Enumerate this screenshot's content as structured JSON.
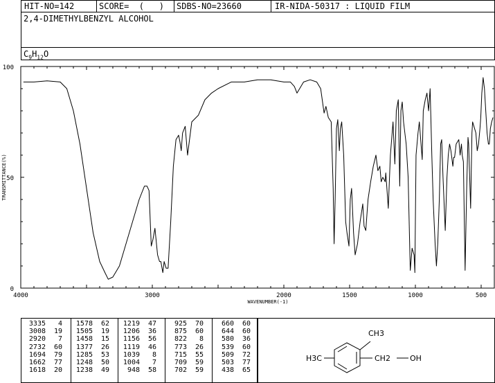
{
  "header": {
    "hit_no": "HIT-NO=142",
    "score": "SCORE=  (   )",
    "sdbs_no": "SDBS-NO=23660",
    "ir_info": "IR-NIDA-50317 : LIQUID FILM"
  },
  "compound": {
    "name": "2,4-DIMETHYLBENZYL ALCOHOL",
    "formula": {
      "c": "C",
      "c_count": "9",
      "h": "H",
      "h_count": "12",
      "o": "O"
    }
  },
  "chart_data": {
    "type": "line",
    "xlabel": "WAVENUMBER(-1)",
    "ylabel": "TRANSMITTANCE(%)",
    "xlim": [
      4000,
      400
    ],
    "ylim": [
      0,
      100
    ],
    "x_ticks": [
      "4000",
      "3000",
      "2000",
      "1500",
      "1000",
      "500"
    ],
    "y_ticks": [
      "100",
      "50",
      "0"
    ],
    "series": [
      {
        "points": [
          [
            3980,
            93
          ],
          [
            3900,
            93
          ],
          [
            3800,
            93.5
          ],
          [
            3700,
            93
          ],
          [
            3650,
            90
          ],
          [
            3600,
            80
          ],
          [
            3550,
            65
          ],
          [
            3500,
            45
          ],
          [
            3450,
            25
          ],
          [
            3400,
            12
          ],
          [
            3360,
            7
          ],
          [
            3335,
            4
          ],
          [
            3300,
            5
          ],
          [
            3250,
            10
          ],
          [
            3200,
            20
          ],
          [
            3150,
            30
          ],
          [
            3100,
            40
          ],
          [
            3060,
            46
          ],
          [
            3040,
            46
          ],
          [
            3025,
            44
          ],
          [
            3008,
            19
          ],
          [
            2995,
            22
          ],
          [
            2980,
            27
          ],
          [
            2960,
            15
          ],
          [
            2945,
            12
          ],
          [
            2935,
            12
          ],
          [
            2920,
            7
          ],
          [
            2910,
            12
          ],
          [
            2895,
            9
          ],
          [
            2880,
            9
          ],
          [
            2860,
            30
          ],
          [
            2840,
            55
          ],
          [
            2820,
            67
          ],
          [
            2800,
            69
          ],
          [
            2790,
            66
          ],
          [
            2780,
            62
          ],
          [
            2770,
            70
          ],
          [
            2750,
            73
          ],
          [
            2732,
            60
          ],
          [
            2700,
            75
          ],
          [
            2650,
            78
          ],
          [
            2600,
            85
          ],
          [
            2550,
            88
          ],
          [
            2500,
            90
          ],
          [
            2400,
            93
          ],
          [
            2300,
            93
          ],
          [
            2200,
            94
          ],
          [
            2100,
            94
          ],
          [
            2000,
            93
          ],
          [
            1950,
            93
          ],
          [
            1920,
            91
          ],
          [
            1900,
            88
          ],
          [
            1880,
            90
          ],
          [
            1850,
            93
          ],
          [
            1800,
            94
          ],
          [
            1750,
            93
          ],
          [
            1720,
            90
          ],
          [
            1694,
            79
          ],
          [
            1680,
            82
          ],
          [
            1662,
            77
          ],
          [
            1640,
            75
          ],
          [
            1625,
            45
          ],
          [
            1618,
            20
          ],
          [
            1610,
            40
          ],
          [
            1600,
            72
          ],
          [
            1590,
            76
          ],
          [
            1578,
            62
          ],
          [
            1570,
            72
          ],
          [
            1560,
            75
          ],
          [
            1545,
            60
          ],
          [
            1530,
            30
          ],
          [
            1520,
            25
          ],
          [
            1505,
            19
          ],
          [
            1495,
            40
          ],
          [
            1485,
            45
          ],
          [
            1470,
            25
          ],
          [
            1458,
            15
          ],
          [
            1440,
            20
          ],
          [
            1420,
            30
          ],
          [
            1400,
            38
          ],
          [
            1390,
            28
          ],
          [
            1377,
            26
          ],
          [
            1360,
            40
          ],
          [
            1340,
            48
          ],
          [
            1320,
            55
          ],
          [
            1300,
            60
          ],
          [
            1285,
            53
          ],
          [
            1270,
            55
          ],
          [
            1260,
            48
          ],
          [
            1248,
            50
          ],
          [
            1238,
            49
          ],
          [
            1230,
            48
          ],
          [
            1225,
            52
          ],
          [
            1219,
            47
          ],
          [
            1206,
            36
          ],
          [
            1190,
            60
          ],
          [
            1170,
            75
          ],
          [
            1156,
            56
          ],
          [
            1145,
            80
          ],
          [
            1130,
            85
          ],
          [
            1119,
            46
          ],
          [
            1110,
            80
          ],
          [
            1100,
            84
          ],
          [
            1090,
            75
          ],
          [
            1070,
            65
          ],
          [
            1055,
            50
          ],
          [
            1039,
            8
          ],
          [
            1025,
            18
          ],
          [
            1010,
            15
          ],
          [
            1004,
            7
          ],
          [
            995,
            60
          ],
          [
            980,
            70
          ],
          [
            970,
            75
          ],
          [
            948,
            58
          ],
          [
            940,
            80
          ],
          [
            925,
            85
          ],
          [
            912,
            88
          ],
          [
            900,
            80
          ],
          [
            888,
            90
          ],
          [
            875,
            60
          ],
          [
            865,
            40
          ],
          [
            850,
            20
          ],
          [
            840,
            10
          ],
          [
            830,
            20
          ],
          [
            818,
            40
          ],
          [
            808,
            65
          ],
          [
            800,
            67
          ],
          [
            790,
            50
          ],
          [
            773,
            26
          ],
          [
            760,
            50
          ],
          [
            750,
            60
          ],
          [
            740,
            65
          ],
          [
            730,
            62
          ],
          [
            715,
            55
          ],
          [
            709,
            59
          ],
          [
            702,
            59
          ],
          [
            690,
            65
          ],
          [
            680,
            66
          ],
          [
            670,
            67
          ],
          [
            660,
            60
          ],
          [
            650,
            65
          ],
          [
            644,
            60
          ],
          [
            635,
            57
          ],
          [
            622,
            8
          ],
          [
            610,
            45
          ],
          [
            600,
            68
          ],
          [
            595,
            65
          ],
          [
            580,
            36
          ],
          [
            570,
            70
          ],
          [
            565,
            75
          ],
          [
            560,
            74
          ],
          [
            540,
            70
          ],
          [
            530,
            62
          ],
          [
            520,
            65
          ],
          [
            509,
            72
          ],
          [
            503,
            77
          ],
          [
            495,
            88
          ],
          [
            485,
            95
          ],
          [
            475,
            90
          ],
          [
            465,
            80
          ],
          [
            455,
            70
          ],
          [
            445,
            65
          ],
          [
            438,
            65
          ],
          [
            430,
            72
          ],
          [
            420,
            75
          ],
          [
            410,
            77
          ]
        ]
      }
    ]
  },
  "peak_table": {
    "columns": [
      [
        [
          3335,
          4
        ],
        [
          3008,
          19
        ],
        [
          2920,
          7
        ],
        [
          2732,
          60
        ],
        [
          1694,
          79
        ],
        [
          1662,
          77
        ],
        [
          1618,
          20
        ]
      ],
      [
        [
          1578,
          62
        ],
        [
          1505,
          19
        ],
        [
          1458,
          15
        ],
        [
          1377,
          26
        ],
        [
          1285,
          53
        ],
        [
          1248,
          50
        ],
        [
          1238,
          49
        ]
      ],
      [
        [
          1219,
          47
        ],
        [
          1206,
          36
        ],
        [
          1156,
          56
        ],
        [
          1119,
          46
        ],
        [
          1039,
          8
        ],
        [
          1004,
          7
        ],
        [
          948,
          58
        ]
      ],
      [
        [
          925,
          70
        ],
        [
          875,
          60
        ],
        [
          822,
          8
        ],
        [
          773,
          26
        ],
        [
          715,
          55
        ],
        [
          709,
          59
        ],
        [
          702,
          59
        ]
      ],
      [
        [
          660,
          60
        ],
        [
          644,
          60
        ],
        [
          580,
          36
        ],
        [
          539,
          60
        ],
        [
          509,
          72
        ],
        [
          503,
          77
        ],
        [
          438,
          65
        ]
      ]
    ]
  },
  "structure": {
    "left_group": "H3C",
    "top_group": "CH3",
    "right_group": "CH2",
    "oh_group": "OH"
  }
}
